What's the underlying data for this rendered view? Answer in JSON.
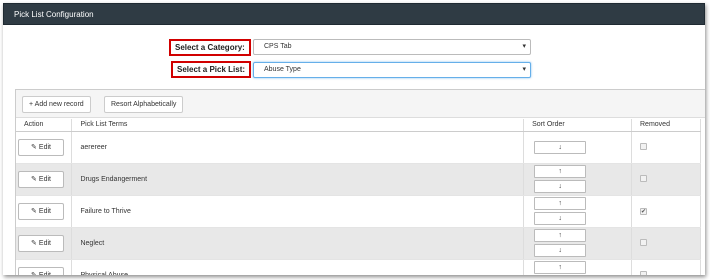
{
  "window": {
    "title": "Pick List Configuration"
  },
  "category": {
    "label": "Select a Category:",
    "value": "CPS Tab"
  },
  "picklist": {
    "label": "Select a Pick List:",
    "value": "Abuse Type"
  },
  "toolbar": {
    "add_label": "+ Add new record",
    "sort_label": "Resort Alphabetically"
  },
  "table": {
    "headers": {
      "action": "Action",
      "terms": "Pick List Terms",
      "sort": "Sort Order",
      "removed": "Removed"
    },
    "edit_label": "Edit",
    "rows": [
      {
        "term": "aerereer",
        "up": false,
        "down": true,
        "removed": false
      },
      {
        "term": "Drugs Endangerment",
        "up": true,
        "down": true,
        "removed": false
      },
      {
        "term": "Failure to Thrive",
        "up": true,
        "down": true,
        "removed": true
      },
      {
        "term": "Neglect",
        "up": true,
        "down": true,
        "removed": false
      },
      {
        "term": "Physical Abuse",
        "up": true,
        "down": true,
        "removed": false
      }
    ]
  },
  "icons": {
    "up": "↑",
    "down": "↓",
    "pencil": "✎",
    "check": "✔",
    "caret": "▾"
  }
}
